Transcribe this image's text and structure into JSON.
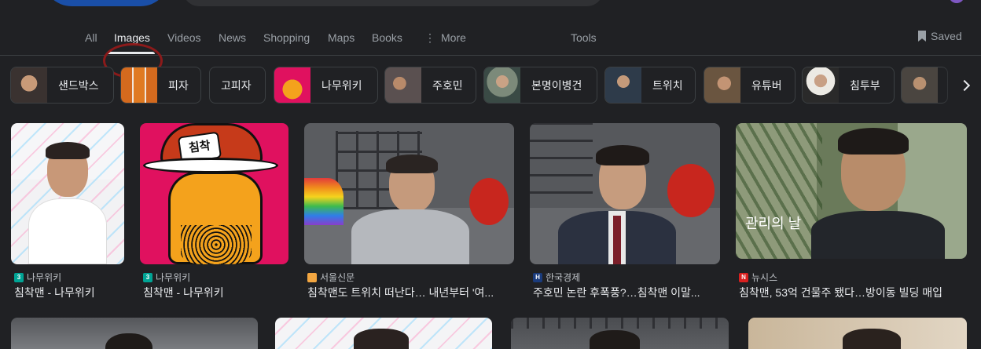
{
  "tabs": [
    {
      "label": "All"
    },
    {
      "label": "Images"
    },
    {
      "label": "Videos"
    },
    {
      "label": "News"
    },
    {
      "label": "Shopping"
    },
    {
      "label": "Maps"
    },
    {
      "label": "Books"
    },
    {
      "label": "More"
    },
    {
      "label": "Tools"
    }
  ],
  "saved_label": "Saved",
  "chips": [
    {
      "label": "샌드박스",
      "thumb": "photo"
    },
    {
      "label": "피자",
      "thumb": "photo"
    },
    {
      "label": "고피자",
      "thumb": "none"
    },
    {
      "label": "나무위키",
      "thumb": "cartoon"
    },
    {
      "label": "주호민",
      "thumb": "photo"
    },
    {
      "label": "본명이병건",
      "thumb": "photo"
    },
    {
      "label": "트위치",
      "thumb": "photo"
    },
    {
      "label": "유튜버",
      "thumb": "photo"
    },
    {
      "label": "침투부",
      "thumb": "photo"
    }
  ],
  "results": [
    {
      "source": "나무위키",
      "title": "침착맨 - 나무위키"
    },
    {
      "source": "나무위키",
      "title": "침착맨 - 나무위키",
      "cap_text": "침착"
    },
    {
      "source": "서울신문",
      "title": "침착맨도 트위치 떠난다… 내년부터 '여..."
    },
    {
      "source": "한국경제",
      "title": "주호민 논란 후폭풍?…침착맨 이말..."
    },
    {
      "source": "뉴시스",
      "title": "침착맨, 53억 건물주 됐다…방이동 빌딩 매입",
      "overlay": "관리의 날"
    }
  ],
  "colors": {
    "background": "#202124",
    "active_tab": "#e8eaed",
    "annotation_circle": "#8b1a1a",
    "cartoon_bg": "#e0115f"
  },
  "icons": {
    "more": "vertical-dots-icon",
    "saved": "bookmark-icon",
    "next": "chevron-right-icon"
  }
}
